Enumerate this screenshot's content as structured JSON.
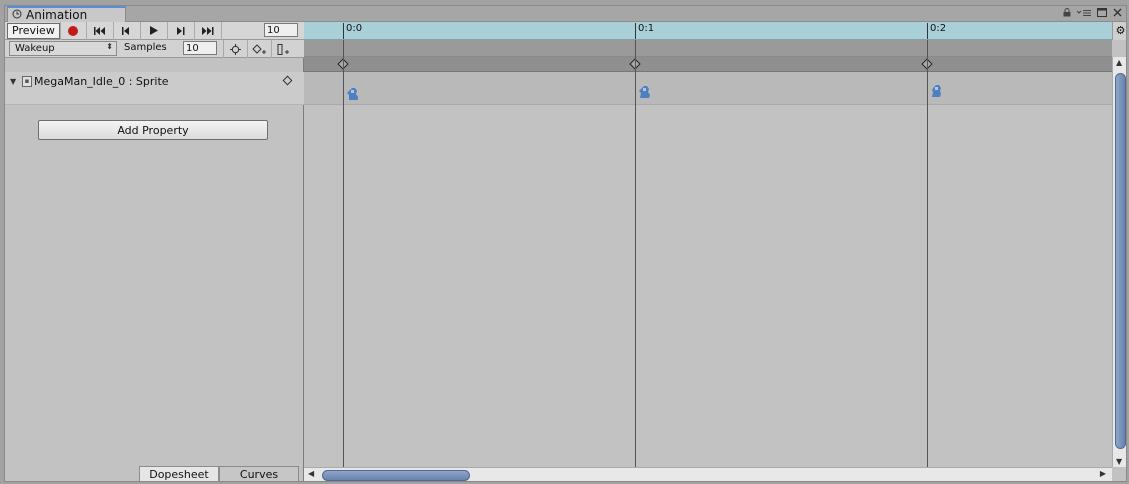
{
  "window": {
    "tab_title": "Animation",
    "controls": [
      "lock-icon",
      "menu-icon",
      "maximize-icon",
      "close-icon"
    ]
  },
  "toolbar": {
    "preview_label": "Preview",
    "frame_value": "10"
  },
  "clip": {
    "name": "Wakeup",
    "samples_label": "Samples",
    "samples_value": "10"
  },
  "property": {
    "name": "MegaMan_Idle_0 : Sprite"
  },
  "add_property_label": "Add Property",
  "view_tabs": {
    "dopesheet": "Dopesheet",
    "curves": "Curves",
    "active": "dopesheet"
  },
  "timeline": {
    "ticks": [
      "0:0",
      "0:1",
      "0:2"
    ],
    "keyframes": [
      {
        "time": "0:0"
      },
      {
        "time": "0:1"
      },
      {
        "time": "0:2"
      }
    ],
    "ruler_color": "#a9d0d9",
    "scroll_color": "#6683ad"
  }
}
